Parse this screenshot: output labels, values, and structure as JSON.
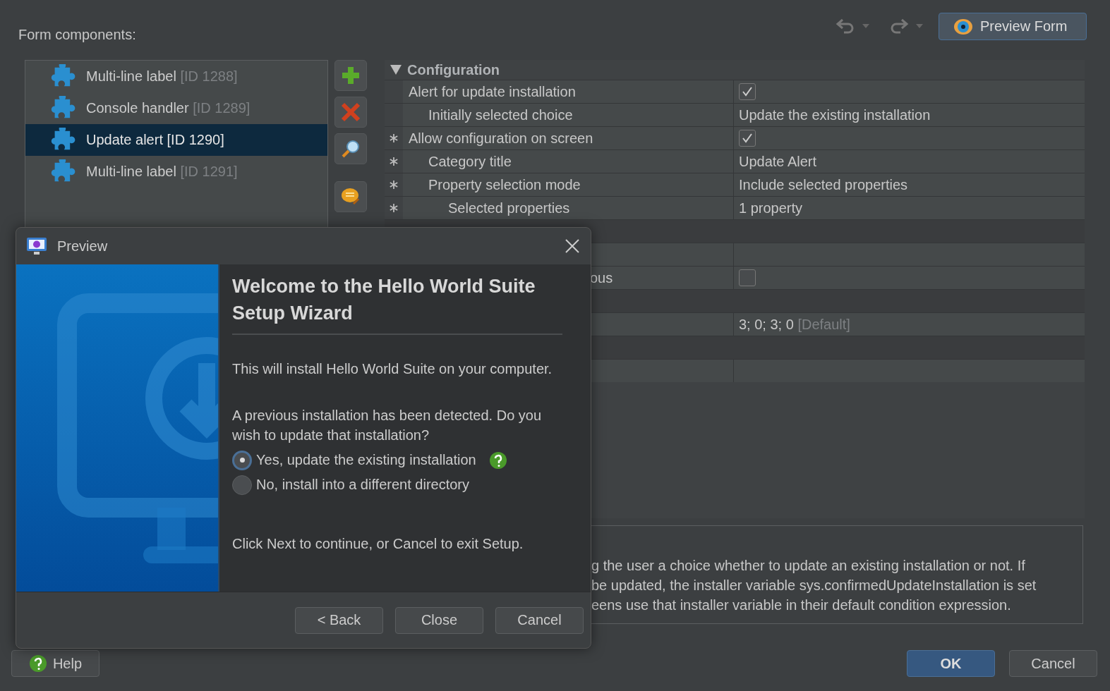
{
  "header": {
    "label": "Form components:",
    "preview_button": "Preview Form"
  },
  "components": [
    {
      "name": "Multi-line label",
      "id": "[ID 1288]",
      "selected": false
    },
    {
      "name": "Console handler",
      "id": "[ID 1289]",
      "selected": false
    },
    {
      "name": "Update alert",
      "id": "[ID 1290]",
      "selected": true
    },
    {
      "name": "Multi-line label",
      "id": "[ID 1291]",
      "selected": false
    }
  ],
  "property_table": {
    "group": {
      "title": "Configuration",
      "expanded": true
    },
    "properties": [
      {
        "label": "Alert for update installation",
        "starred": false,
        "kind": "checkbox",
        "checked": true,
        "children": [
          {
            "label": "Initially selected choice",
            "starred": false,
            "kind": "text",
            "value": "Update the existing installation"
          }
        ]
      },
      {
        "label": "Allow configuration on screen",
        "starred": true,
        "kind": "checkbox",
        "checked": true,
        "children": [
          {
            "label": "Category title",
            "starred": true,
            "kind": "text",
            "value": "Update Alert"
          },
          {
            "label": "Property selection mode",
            "starred": true,
            "kind": "text",
            "value": "Include selected properties",
            "children": [
              {
                "label": "Selected properties",
                "starred": true,
                "kind": "text",
                "value": "1 property"
              }
            ]
          }
        ]
      }
    ],
    "more_rows": [
      {
        "kind": "group"
      },
      {
        "kind": "empty"
      },
      {
        "kind": "checkbox",
        "label": "ous",
        "checked": false
      },
      {
        "kind": "group"
      },
      {
        "kind": "text",
        "value": "3; 0; 3; 0",
        "note": "[Default]"
      },
      {
        "kind": "group"
      },
      {
        "kind": "empty"
      }
    ]
  },
  "description": [
    "g the user a choice whether to update an existing installation or not. If",
    "be updated, the installer variable sys.confirmedUpdateInstallation is set",
    "eens use that installer variable in their default condition expression."
  ],
  "preview": {
    "title": "Preview",
    "heading": "Welcome to the Hello World Suite Setup Wizard",
    "intro": "This will install Hello World Suite on your computer.",
    "question": "A previous installation has been detected. Do you wish to update that installation?",
    "options": [
      {
        "label": "Yes, update the existing installation",
        "selected": true,
        "help": true
      },
      {
        "label": "No, install into a different directory",
        "selected": false,
        "help": false
      }
    ],
    "footer_text": "Click Next to continue, or Cancel to exit Setup.",
    "buttons": [
      "< Back",
      "Close",
      "Cancel"
    ]
  },
  "bottom": {
    "help": "Help",
    "ok": "OK",
    "cancel": "Cancel"
  }
}
